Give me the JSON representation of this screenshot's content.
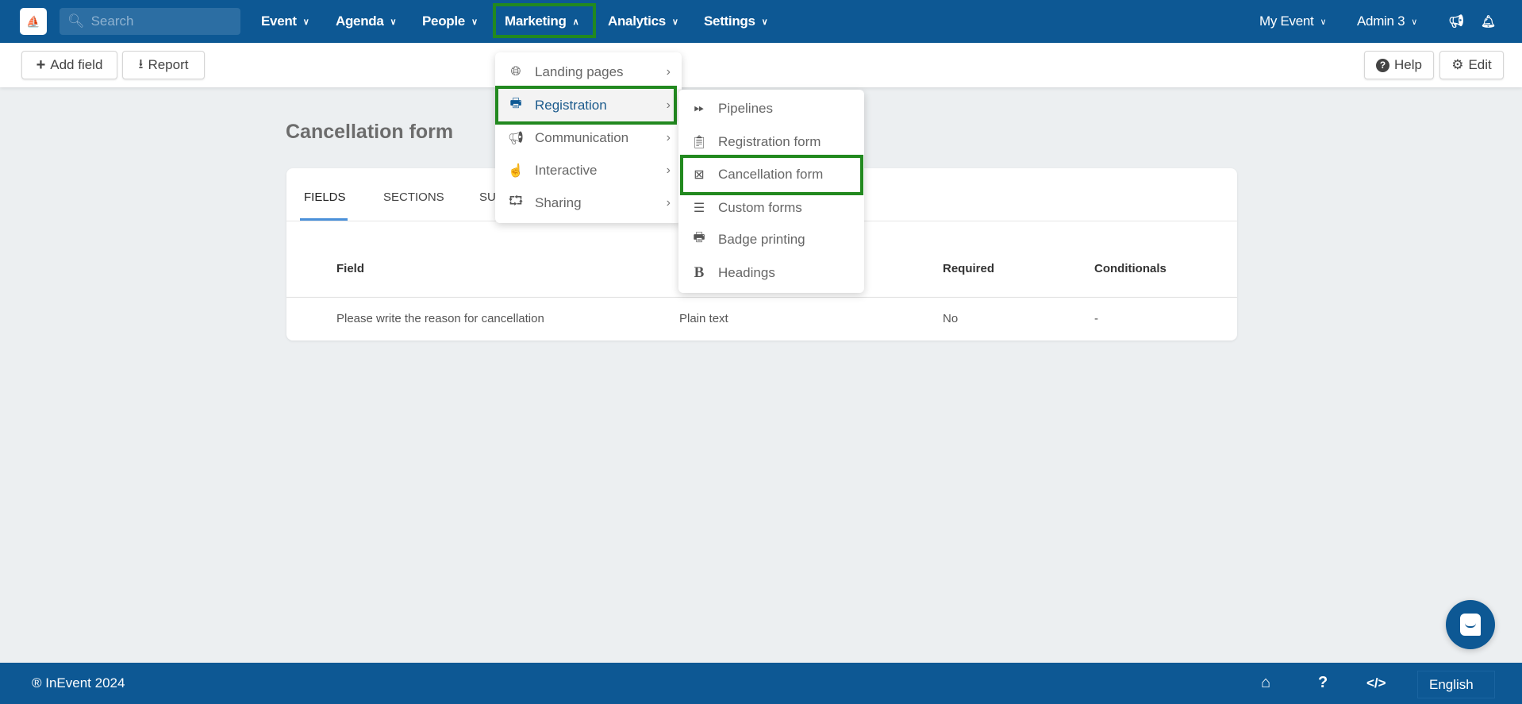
{
  "topnav": {
    "search_placeholder": "Search",
    "items": [
      {
        "label": "Event"
      },
      {
        "label": "Agenda"
      },
      {
        "label": "People"
      },
      {
        "label": "Marketing"
      },
      {
        "label": "Analytics"
      },
      {
        "label": "Settings"
      }
    ],
    "my_event": "My Event",
    "user": "Admin 3"
  },
  "toolbar": {
    "add_field": "Add field",
    "report": "Report",
    "help": "Help",
    "edit": "Edit"
  },
  "page": {
    "title": "Cancellation form"
  },
  "tabs": [
    {
      "label": "FIELDS",
      "active": true
    },
    {
      "label": "SECTIONS"
    },
    {
      "label": "SU"
    }
  ],
  "table": {
    "headers": [
      "Field",
      "Required",
      "Conditionals"
    ],
    "rows": [
      {
        "field": "Please write the reason for cancellation",
        "type": "Plain text",
        "required": "No",
        "conditionals": "-"
      }
    ]
  },
  "marketing_menu": [
    {
      "label": "Landing pages",
      "icon": "globe-icon"
    },
    {
      "label": "Registration",
      "icon": "printer-icon",
      "highlighted": true
    },
    {
      "label": "Communication",
      "icon": "megaphone-icon"
    },
    {
      "label": "Interactive",
      "icon": "hand-pointer-icon"
    },
    {
      "label": "Sharing",
      "icon": "share-icon"
    }
  ],
  "registration_submenu": [
    {
      "label": "Pipelines",
      "icon": "fast-forward-icon"
    },
    {
      "label": "Registration form",
      "icon": "clipboard-icon"
    },
    {
      "label": "Cancellation form",
      "icon": "cancel-form-icon",
      "highlighted": true
    },
    {
      "label": "Custom forms",
      "icon": "list-icon"
    },
    {
      "label": "Badge printing",
      "icon": "printer-icon"
    },
    {
      "label": "Headings",
      "icon": "bold-icon"
    }
  ],
  "footer": {
    "copyright": "® InEvent 2024",
    "language": "English"
  },
  "colors": {
    "primary": "#0d5894",
    "highlight": "#22891f",
    "tab_underline": "#4a90d9"
  }
}
